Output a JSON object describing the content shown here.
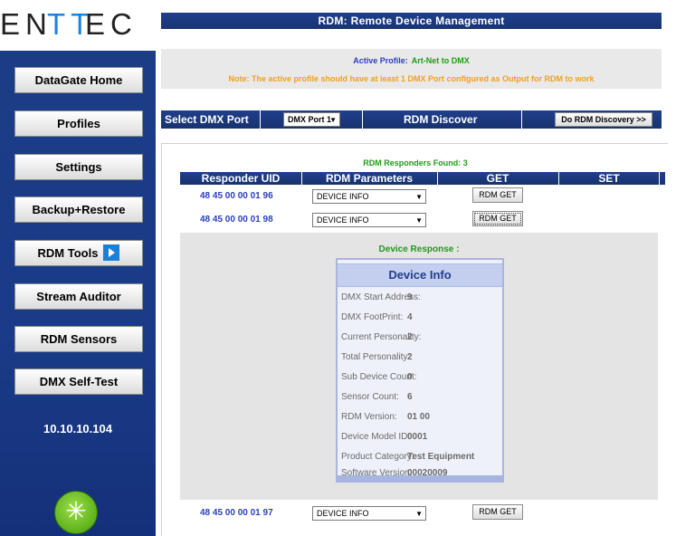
{
  "brand": {
    "logo_part1": "EN",
    "logo_part2": "TT",
    "logo_part3": "EC",
    "accent_color": "#1d82d8"
  },
  "sidebar": {
    "items": [
      {
        "label": "DataGate Home"
      },
      {
        "label": "Profiles"
      },
      {
        "label": "Settings"
      },
      {
        "label": "Backup+Restore"
      },
      {
        "label": "RDM Tools",
        "icon": "play-arrow-icon"
      },
      {
        "label": "Stream Auditor"
      },
      {
        "label": "RDM Sensors"
      },
      {
        "label": "DMX Self-Test"
      }
    ],
    "ip_address": "10.10.10.104",
    "status_icon": "power-icon"
  },
  "header": {
    "title": "RDM: Remote Device Management"
  },
  "profile": {
    "label": "Active Profile:",
    "value": "Art-Net to DMX",
    "note": "Note: The active profile should have at least 1 DMX Port configured as Output for RDM to work"
  },
  "port_bar": {
    "select_label": "Select DMX Port",
    "selected_port": "DMX Port 1",
    "discover_label": "RDM Discover",
    "discover_button": "Do RDM Discovery >>"
  },
  "results": {
    "found_text": "RDM Responders Found: 3",
    "columns": [
      "Responder UID",
      "RDM Parameters",
      "GET",
      "SET"
    ],
    "rows": [
      {
        "uid": "48 45 00 00 01 96",
        "param": "DEVICE INFO",
        "get_label": "RDM GET"
      },
      {
        "uid": "48 45 00 00 01 98",
        "param": "DEVICE INFO",
        "get_label": "RDM GET"
      },
      {
        "uid": "48 45 00 00 01 97",
        "param": "DEVICE INFO",
        "get_label": "RDM GET"
      }
    ]
  },
  "response": {
    "title": "Device Response :",
    "card_title": "Device Info",
    "fields": [
      {
        "label": "DMX Start Address:",
        "value": "9"
      },
      {
        "label": "DMX FootPrint:",
        "value": "4"
      },
      {
        "label": "Current Personality:",
        "value": "2"
      },
      {
        "label": "Total Personality:",
        "value": "2"
      },
      {
        "label": "Sub Device Count:",
        "value": "0"
      },
      {
        "label": "Sensor Count:",
        "value": "6"
      },
      {
        "label": "RDM Version:",
        "value": "01 00"
      },
      {
        "label": "Device Model ID:",
        "value": "0001"
      },
      {
        "label": "Product Category:",
        "value": "Test Equipment"
      },
      {
        "label": "Software Version:",
        "value": "00020009"
      }
    ]
  }
}
